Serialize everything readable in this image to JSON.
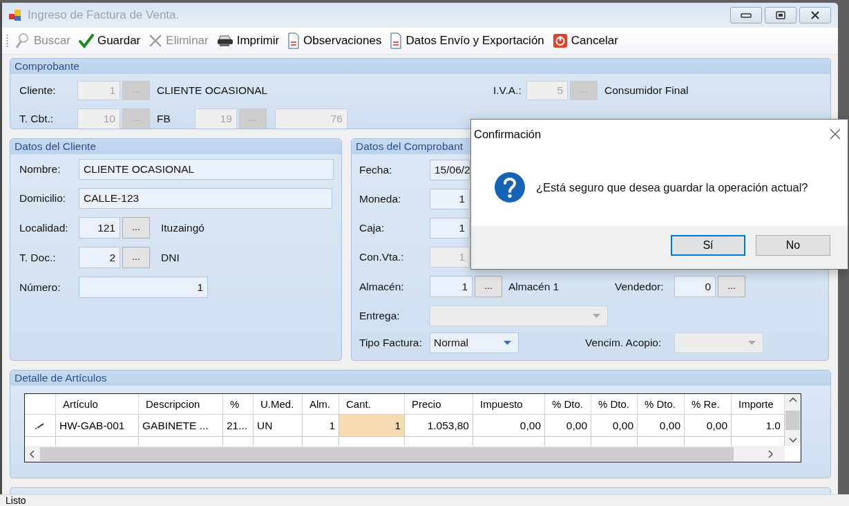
{
  "window": {
    "title": "Ingreso de Factura de Venta."
  },
  "toolbar": [
    {
      "kind": "search",
      "label": "Buscar",
      "disabled": true
    },
    {
      "kind": "save",
      "label": "Guardar",
      "disabled": false
    },
    {
      "kind": "delete",
      "label": "Eliminar",
      "disabled": true
    },
    {
      "kind": "print",
      "label": "Imprimir",
      "disabled": false
    },
    {
      "kind": "document",
      "label": "Observaciones",
      "disabled": false
    },
    {
      "kind": "document",
      "label": "Datos Envío y Exportación",
      "disabled": false
    },
    {
      "kind": "cancel",
      "label": "Cancelar",
      "disabled": false
    }
  ],
  "comprobante": {
    "title": "Comprobante",
    "cliente": {
      "label": "Cliente:",
      "code": {
        "value": "1",
        "disabled": true
      },
      "lookup": {
        "text": "...",
        "disabled": true
      },
      "name": "CLIENTE OCASIONAL"
    },
    "iva": {
      "label": "I.V.A.:",
      "code": {
        "value": "5",
        "disabled": true
      },
      "lookup": {
        "text": "...",
        "disabled": true
      },
      "name": "Consumidor Final"
    },
    "tipo": {
      "label": "T. Cbt.:",
      "code": {
        "value": "10",
        "disabled": true
      },
      "lookup": {
        "text": "...",
        "disabled": true
      },
      "letter": "FB",
      "point": {
        "value": "19",
        "disabled": true
      },
      "point_lookup": {
        "text": "...",
        "disabled": true
      },
      "number": {
        "value": "76",
        "disabled": true
      }
    }
  },
  "cliente": {
    "title": "Datos del Cliente",
    "nombre": {
      "label": "Nombre:",
      "value": "CLIENTE OCASIONAL"
    },
    "domicilio": {
      "label": "Domicilio:",
      "value": "CALLE-123"
    },
    "localidad": {
      "label": "Localidad:",
      "code": {
        "value": "121",
        "disabled": false
      },
      "lookup": {
        "text": "...",
        "disabled": false
      },
      "name": "Ituzaingó"
    },
    "documento": {
      "label": "T. Doc.:",
      "code": {
        "value": "2",
        "disabled": false
      },
      "lookup": {
        "text": "...",
        "disabled": false
      },
      "name": "DNI"
    },
    "numero": {
      "label": "Número:",
      "value": "1"
    }
  },
  "datos_comprobante": {
    "title": "Datos del Comprobant",
    "fecha": {
      "label": "Fecha:",
      "value": "15/06/2",
      "disabled": false
    },
    "moneda": {
      "label": "Moneda:",
      "value": "1",
      "disabled": false
    },
    "caja": {
      "label": "Caja:",
      "value": "1",
      "disabled": false
    },
    "condicion": {
      "label": "Con.Vta.:",
      "value": "1",
      "disabled": true
    },
    "almacen": {
      "label": "Almacén:",
      "code": {
        "value": "1",
        "disabled": false
      },
      "lookup": {
        "text": "...",
        "disabled": false
      },
      "name": "Almacén 1"
    },
    "vendedor": {
      "label": "Vendedor:",
      "code": {
        "value": "0",
        "disabled": false
      },
      "lookup": {
        "text": "...",
        "disabled": false
      }
    },
    "entrega": {
      "label": "Entrega:",
      "disabled": true
    },
    "tipo_factura": {
      "label": "Tipo Factura:",
      "value": "Normal",
      "disabled": false
    },
    "acopio": {
      "label": "Vencim. Acopio:",
      "disabled": true
    }
  },
  "detalle": {
    "title": "Detalle de Artículos",
    "columns": [
      {
        "label": "Artículo",
        "numeric": false
      },
      {
        "label": "Descripcion",
        "numeric": false
      },
      {
        "label": "%",
        "numeric": false
      },
      {
        "label": "U.Med.",
        "numeric": false
      },
      {
        "label": "Alm.",
        "numeric": true
      },
      {
        "label": "Cant.",
        "numeric": true
      },
      {
        "label": "Precio",
        "numeric": true
      },
      {
        "label": "Impuesto",
        "numeric": true
      },
      {
        "label": "% Dto.",
        "numeric": true
      },
      {
        "label": "% Dto.",
        "numeric": true
      },
      {
        "label": "% Dto.",
        "numeric": true
      },
      {
        "label": "% Re.",
        "numeric": true
      },
      {
        "label": "Importe",
        "numeric": true
      }
    ],
    "rows": [
      {
        "editing": true,
        "cells": [
          {
            "text": "HW-GAB-001",
            "selected": false
          },
          {
            "text": "GABINETE ...",
            "selected": false
          },
          {
            "text": "21...",
            "selected": false
          },
          {
            "text": "UN",
            "selected": false
          },
          {
            "text": "1",
            "selected": false
          },
          {
            "text": "1",
            "selected": true
          },
          {
            "text": "1.053,80",
            "selected": false
          },
          {
            "text": "0,00",
            "selected": false
          },
          {
            "text": "0,00",
            "selected": false
          },
          {
            "text": "0,00",
            "selected": false
          },
          {
            "text": "0,00",
            "selected": false
          },
          {
            "text": "0,00",
            "selected": false
          },
          {
            "text": "1.0",
            "selected": false
          }
        ]
      }
    ]
  },
  "dialog": {
    "title": "Confirmación",
    "message": "¿Está seguro que desea guardar la operación actual?",
    "buttons": [
      {
        "label": "Sí",
        "default": true
      },
      {
        "label": "No",
        "default": false
      }
    ]
  },
  "status_bar": "Listo"
}
